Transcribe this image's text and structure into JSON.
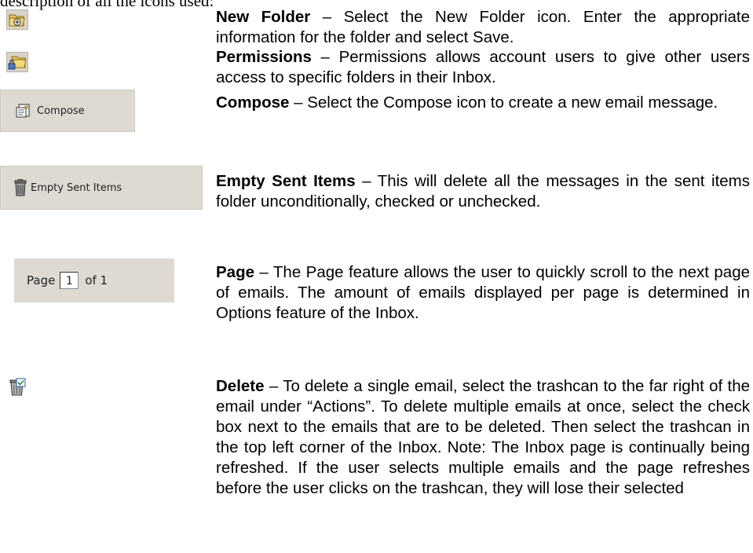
{
  "partial_heading": "description of all the icons used:",
  "items": [
    {
      "icon": "new-folder-icon",
      "title": "New Folder",
      "dash": " – ",
      "text": "Select the New Folder icon. Enter the appropriate information for the folder and select Save."
    },
    {
      "icon": "permissions-folder-icon",
      "title": "Permissions",
      "dash": " – ",
      "text": "Permissions allows account users to give other users access to specific folders in their Inbox."
    },
    {
      "icon": "compose-icon",
      "button_label": "Compose",
      "title": "Compose",
      "dash": " – ",
      "text": "Select the Compose icon to create a new email message."
    },
    {
      "icon": "trash-icon",
      "button_label": "Empty Sent Items",
      "title": "Empty Sent Items",
      "dash": " – ",
      "text": "This will delete all the messages in the sent items folder unconditionally, checked or unchecked."
    },
    {
      "page_label": "Page",
      "page_value": "1",
      "page_of": "of 1",
      "title": "Page",
      "dash": " – ",
      "text": "The Page feature allows the user to quickly scroll to the next page of emails. The amount of emails displayed per page is determined in Options feature of the Inbox."
    },
    {
      "icon": "delete-icon",
      "title": "Delete",
      "dash": " – ",
      "text": "To delete a single email, select the trashcan to the far right of the email under “Actions”. To delete multiple emails at once, select the check box next to the emails that are to be deleted. Then select the trashcan in the top left corner of the Inbox. Note: The Inbox page is continually being refreshed. If the user selects multiple emails and the page refreshes before the user clicks on the trashcan, they will lose their selected"
    }
  ],
  "colors": {
    "button_bg": "#dedad2",
    "folder_yellow": "#e8c24a"
  }
}
